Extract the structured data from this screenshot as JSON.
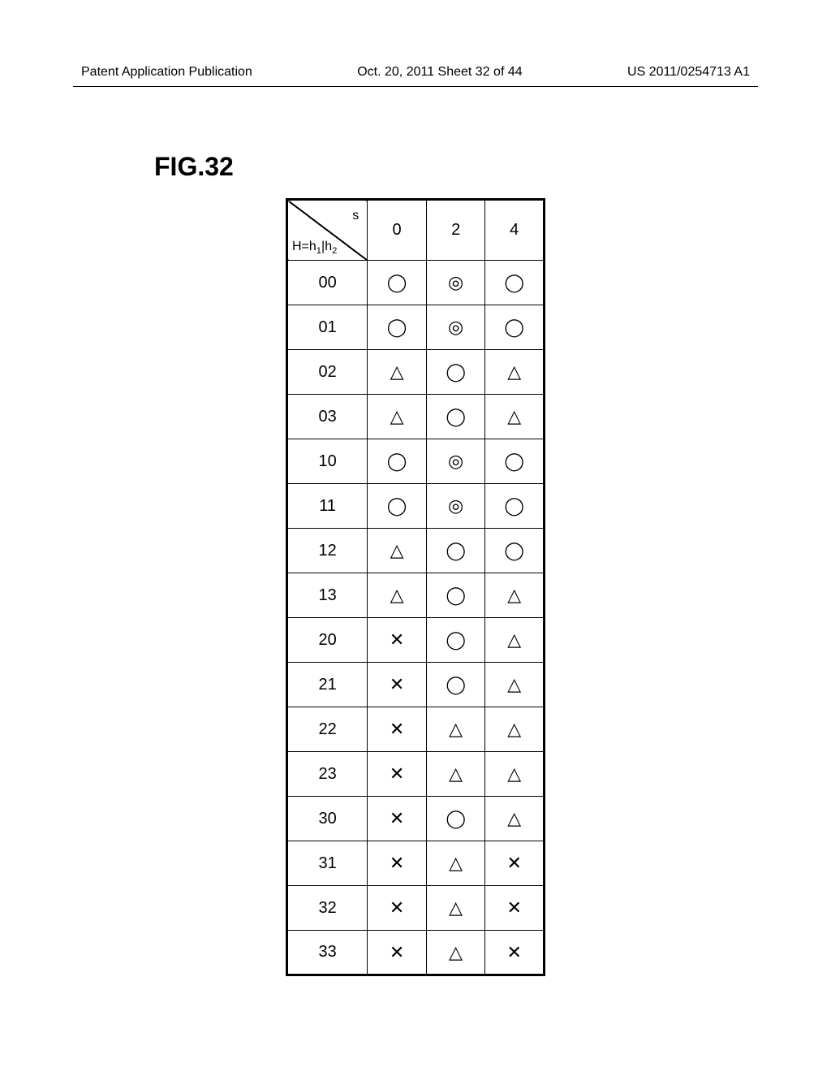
{
  "header": {
    "left": "Patent Application Publication",
    "center": "Oct. 20, 2011 Sheet 32 of 44",
    "right": "US 2011/0254713 A1"
  },
  "figure_label": "FIG.32",
  "table": {
    "diag_top": "s",
    "diag_bottom_html": "H=h₁|h₂",
    "col_headers": [
      "0",
      "2",
      "4"
    ],
    "rows": [
      {
        "h": "00",
        "cells": [
          "circle",
          "double",
          "circle"
        ]
      },
      {
        "h": "01",
        "cells": [
          "circle",
          "double",
          "circle"
        ]
      },
      {
        "h": "02",
        "cells": [
          "triangle",
          "circle",
          "triangle"
        ]
      },
      {
        "h": "03",
        "cells": [
          "triangle",
          "circle",
          "triangle"
        ]
      },
      {
        "h": "10",
        "cells": [
          "circle",
          "double",
          "circle"
        ]
      },
      {
        "h": "11",
        "cells": [
          "circle",
          "double",
          "circle"
        ]
      },
      {
        "h": "12",
        "cells": [
          "triangle",
          "circle",
          "circle"
        ]
      },
      {
        "h": "13",
        "cells": [
          "triangle",
          "circle",
          "triangle"
        ]
      },
      {
        "h": "20",
        "cells": [
          "cross",
          "circle",
          "triangle"
        ]
      },
      {
        "h": "21",
        "cells": [
          "cross",
          "circle",
          "triangle"
        ]
      },
      {
        "h": "22",
        "cells": [
          "cross",
          "triangle",
          "triangle"
        ]
      },
      {
        "h": "23",
        "cells": [
          "cross",
          "triangle",
          "triangle"
        ]
      },
      {
        "h": "30",
        "cells": [
          "cross",
          "circle",
          "triangle"
        ]
      },
      {
        "h": "31",
        "cells": [
          "cross",
          "triangle",
          "cross"
        ]
      },
      {
        "h": "32",
        "cells": [
          "cross",
          "triangle",
          "cross"
        ]
      },
      {
        "h": "33",
        "cells": [
          "cross",
          "triangle",
          "cross"
        ]
      }
    ]
  },
  "symbols": {
    "circle": "◯",
    "double": "◎",
    "triangle": "△",
    "cross": "✕"
  }
}
